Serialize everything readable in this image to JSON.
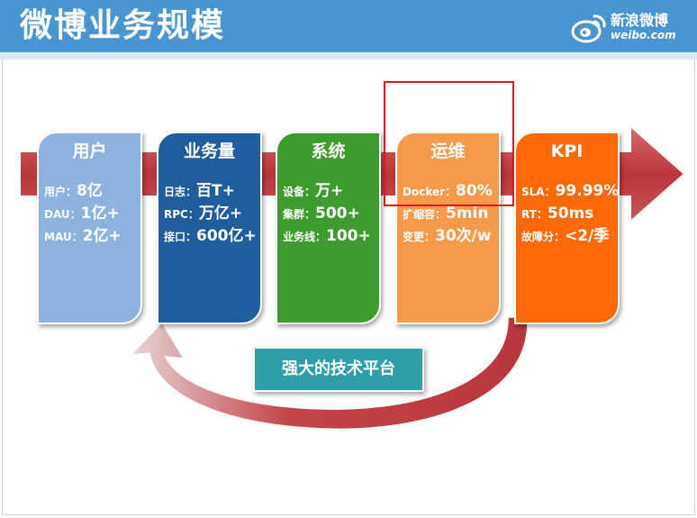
{
  "header": {
    "title": "微博业务规模",
    "logo_cn": "新浪微博",
    "logo_en": "weibo.com",
    "bg_color": "#4a95cf"
  },
  "cards": [
    {
      "title": "用户",
      "color": "#8eb2de",
      "rows": [
        {
          "label": "用户：",
          "value": "8亿"
        },
        {
          "label": "DAU：",
          "value": "1亿+"
        },
        {
          "label": "MAU：",
          "value": "2亿+"
        }
      ]
    },
    {
      "title": "业务量",
      "color": "#1f5d9c",
      "rows": [
        {
          "label": "日志：",
          "value": "百T+"
        },
        {
          "label": "RPC：",
          "value": "万亿+"
        },
        {
          "label": "接口：",
          "value": "600亿+"
        }
      ]
    },
    {
      "title": "系统",
      "color": "#3f9a2f",
      "rows": [
        {
          "label": "设备：",
          "value": "万+"
        },
        {
          "label": "集群：",
          "value": "500+"
        },
        {
          "label": "业务线：",
          "value": "100+"
        }
      ]
    },
    {
      "title": "运维",
      "color": "#f59a4a",
      "rows": [
        {
          "label": "Docker：",
          "value": "80%"
        },
        {
          "label": "扩缩容：",
          "value": "5min"
        },
        {
          "label": "变更：",
          "value": "30次/w"
        }
      ]
    },
    {
      "title": "KPI",
      "color": "#ff6a08",
      "rows": [
        {
          "label": "SLA：",
          "value": "99.99%"
        },
        {
          "label": "RT：",
          "value": "50ms"
        },
        {
          "label": "故障分：",
          "value": "<2/季"
        }
      ]
    }
  ],
  "platform": {
    "label": "强大的技术平台"
  },
  "colors": {
    "arrow": "#c0444a",
    "highlight": "#e0161b",
    "platform": "#2e9ea8"
  }
}
